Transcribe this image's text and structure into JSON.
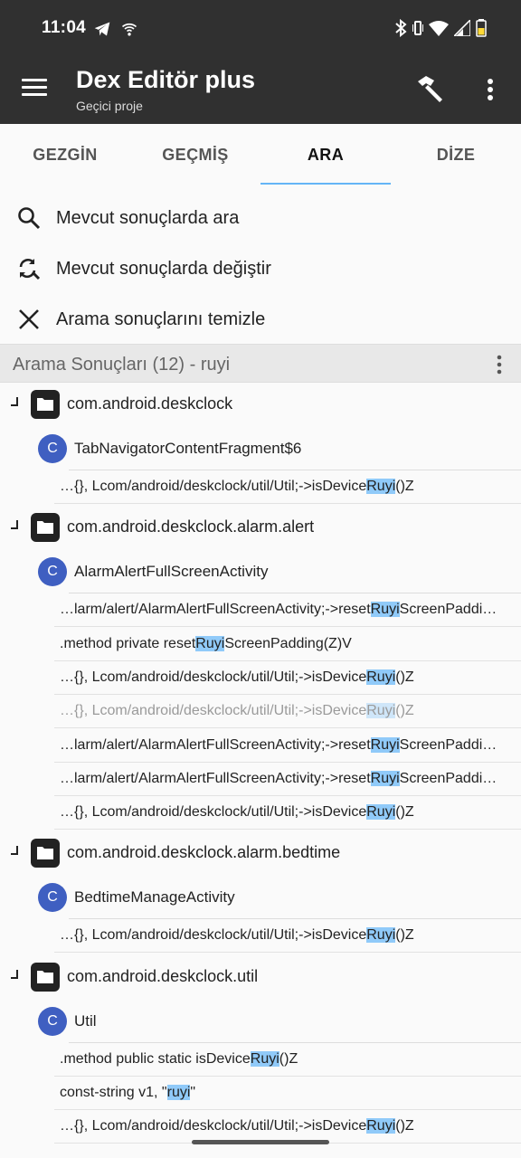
{
  "status_bar": {
    "time": "11:04",
    "left_icons": [
      "telegram-icon",
      "wifi-calling-icon"
    ],
    "right_icons": [
      "bluetooth-icon",
      "vibrate-icon",
      "wifi-icon",
      "signal-icon",
      "battery-icon"
    ]
  },
  "app_bar": {
    "title": "Dex Editör plus",
    "subtitle": "Geçici proje"
  },
  "tabs": [
    "GEZGİN",
    "GEÇMİŞ",
    "ARA",
    "DİZE"
  ],
  "active_tab": "ARA",
  "actions": [
    {
      "label": "Mevcut sonuçlarda ara",
      "icon": "search-icon"
    },
    {
      "label": "Mevcut sonuçlarda değiştir",
      "icon": "find-replace-icon"
    },
    {
      "label": "Arama sonuçlarını temizle",
      "icon": "close-icon"
    }
  ],
  "results_header": "Arama Sonuçları (12) - ruyi",
  "colors": {
    "app_bar": "#303030",
    "accent": "#64b5f6",
    "highlight": "#90caf9",
    "class_badge": "#3f5fc1"
  },
  "results": [
    {
      "package": "com.android.deskclock",
      "classes": [
        {
          "name": "TabNavigatorContentFragment$6",
          "matches": [
            {
              "pre": "…{}, Lcom/android/deskclock/util/Util;->isDevice",
              "hit": "Ruyi",
              "post": "()Z"
            }
          ]
        }
      ]
    },
    {
      "package": "com.android.deskclock.alarm.alert",
      "classes": [
        {
          "name": "AlarmAlertFullScreenActivity",
          "matches": [
            {
              "pre": "…larm/alert/AlarmAlertFullScreenActivity;->reset",
              "hit": "Ruyi",
              "post": "ScreenPaddi…"
            },
            {
              "pre": ".method private reset",
              "hit": "Ruyi",
              "post": "ScreenPadding(Z)V"
            },
            {
              "pre": "…{}, Lcom/android/deskclock/util/Util;->isDevice",
              "hit": "Ruyi",
              "post": "()Z"
            },
            {
              "pre": "…{}, Lcom/android/deskclock/util/Util;->isDevice",
              "hit": "Ruyi",
              "post": "()Z"
            },
            {
              "pre": "…larm/alert/AlarmAlertFullScreenActivity;->reset",
              "hit": "Ruyi",
              "post": "ScreenPaddi…"
            },
            {
              "pre": "…larm/alert/AlarmAlertFullScreenActivity;->reset",
              "hit": "Ruyi",
              "post": "ScreenPaddi…"
            },
            {
              "pre": "…{}, Lcom/android/deskclock/util/Util;->isDevice",
              "hit": "Ruyi",
              "post": "()Z"
            }
          ]
        }
      ]
    },
    {
      "package": "com.android.deskclock.alarm.bedtime",
      "classes": [
        {
          "name": "BedtimeManageActivity",
          "matches": [
            {
              "pre": "…{}, Lcom/android/deskclock/util/Util;->isDevice",
              "hit": "Ruyi",
              "post": "()Z"
            }
          ]
        }
      ]
    },
    {
      "package": "com.android.deskclock.util",
      "classes": [
        {
          "name": "Util",
          "matches": [
            {
              "pre": ".method public static isDevice",
              "hit": "Ruyi",
              "post": "()Z"
            },
            {
              "pre": "const-string v1, \"",
              "hit": "ruyi",
              "post": "\""
            },
            {
              "pre": "…{}, Lcom/android/deskclock/util/Util;->isDevice",
              "hit": "Ruyi",
              "post": "()Z"
            }
          ]
        }
      ]
    }
  ]
}
